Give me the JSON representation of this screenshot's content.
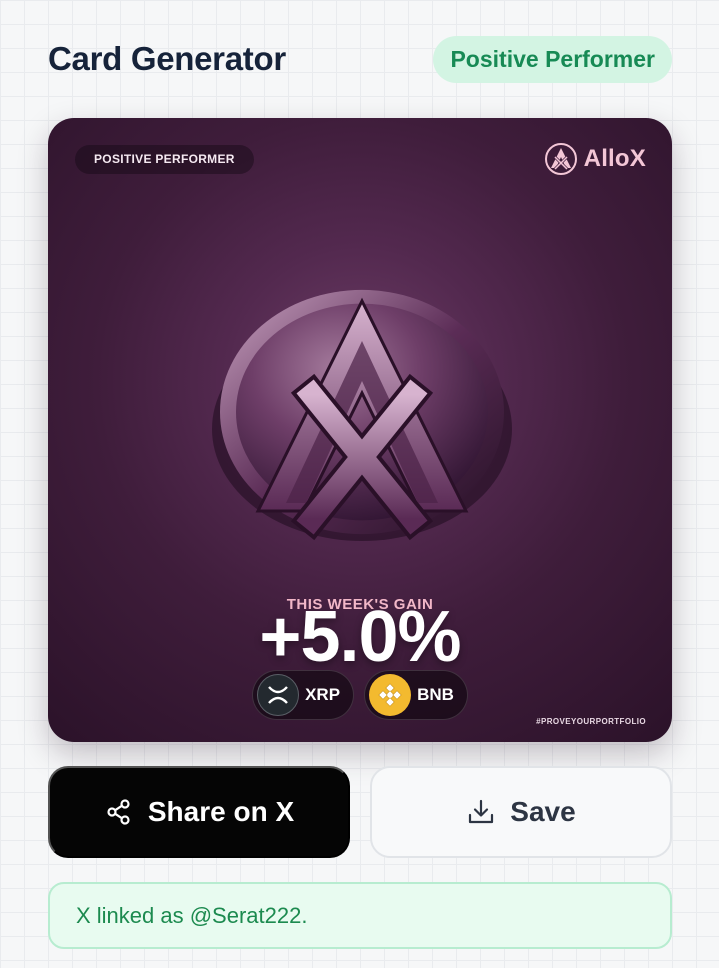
{
  "header": {
    "title": "Card Generator",
    "badge": "Positive Performer"
  },
  "card": {
    "tag": "POSITIVE PERFORMER",
    "brand": "AlloX",
    "gain_label": "THIS WEEK'S GAIN",
    "gain_value": "+5.0%",
    "tokens": [
      {
        "symbol": "XRP",
        "icon": "xrp-icon",
        "color": "#23292f"
      },
      {
        "symbol": "BNB",
        "icon": "bnb-icon",
        "color": "#f3ba2f"
      }
    ],
    "hashtag": "#PROVEYOURPORTFOLIO"
  },
  "actions": {
    "share_label": "Share on X",
    "save_label": "Save"
  },
  "status": {
    "linked_text": "X linked as @Serat222."
  },
  "colors": {
    "badge_bg": "#d3f4e3",
    "badge_text": "#178a55",
    "card_bg": "#4a2446",
    "share_bg": "#050505",
    "linked_bg": "#e8fbf0"
  }
}
